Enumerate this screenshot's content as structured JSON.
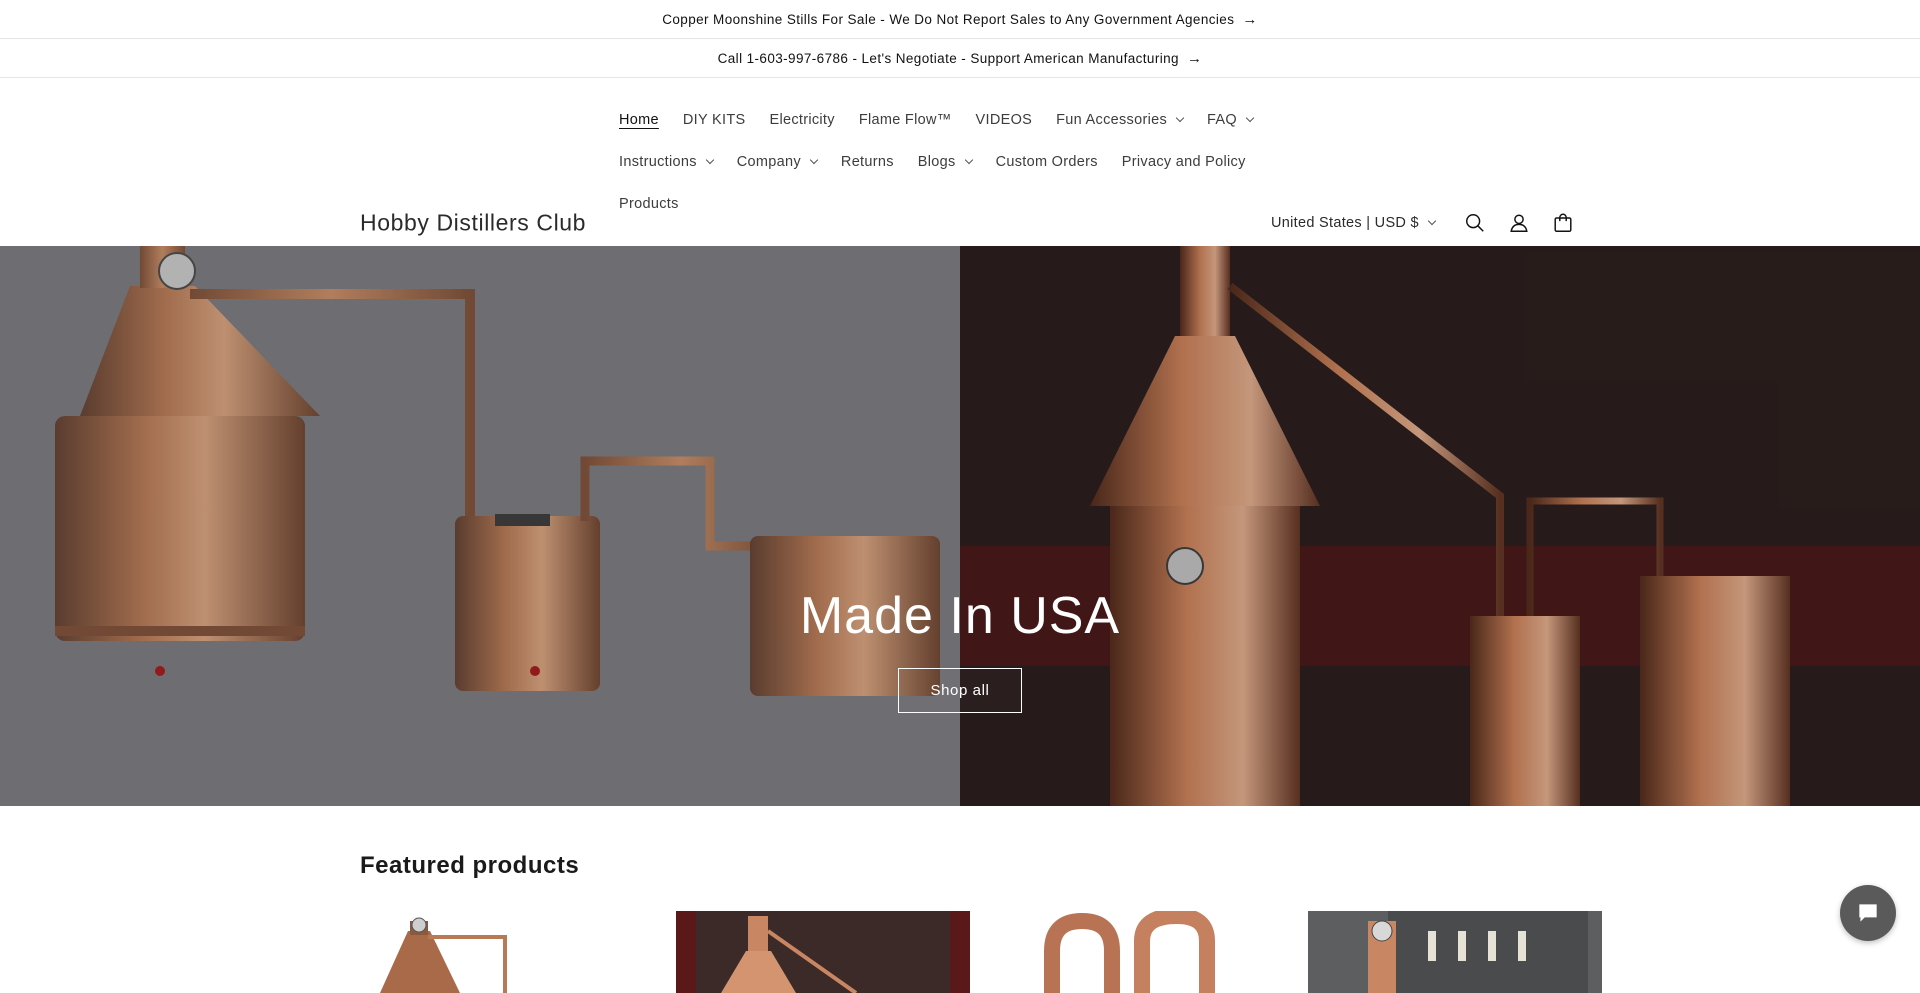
{
  "announcements": [
    {
      "text": "Copper Moonshine Stills For Sale - We Do Not Report Sales to Any Government Agencies"
    },
    {
      "text": "Call 1-603-997-6786 - Let's Negotiate - Support American Manufacturing"
    }
  ],
  "header": {
    "logo": "Hobby Distillers Club",
    "nav": [
      {
        "label": "Home",
        "active": true
      },
      {
        "label": "DIY KITS"
      },
      {
        "label": "Electricity"
      },
      {
        "label": "Flame Flow™"
      },
      {
        "label": "VIDEOS"
      },
      {
        "label": "Fun Accessories",
        "dropdown": true
      },
      {
        "label": "FAQ",
        "dropdown": true
      },
      {
        "label": "Instructions",
        "dropdown": true
      },
      {
        "label": "Company",
        "dropdown": true
      },
      {
        "label": "Returns"
      },
      {
        "label": "Blogs",
        "dropdown": true
      },
      {
        "label": "Custom Orders"
      },
      {
        "label": "Privacy and Policy"
      },
      {
        "label": "Products"
      }
    ],
    "country_selector": "United States | USD $",
    "icons": [
      "search-icon",
      "account-icon",
      "cart-icon"
    ]
  },
  "hero": {
    "title": "Made In USA",
    "button_label": "Shop all"
  },
  "featured": {
    "title": "Featured products"
  },
  "colors": {
    "copper": "#b87333",
    "dark_text": "#121212",
    "chat_button": "#5a5a5a"
  }
}
